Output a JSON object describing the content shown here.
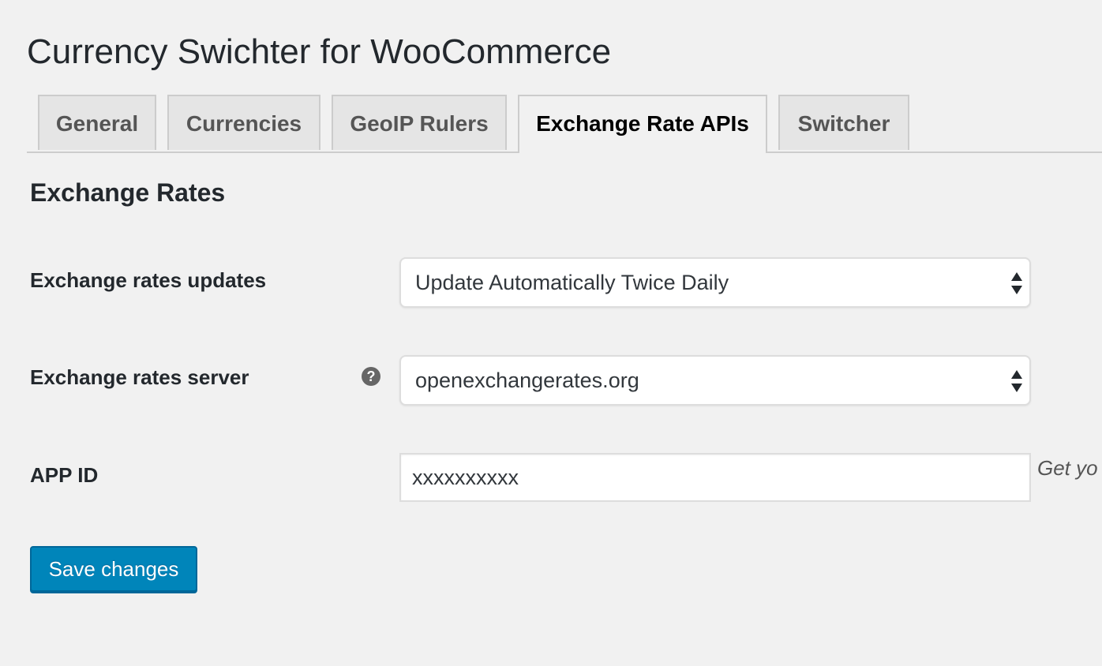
{
  "page": {
    "title": "Currency Swichter for WooCommerce"
  },
  "tabs": [
    {
      "label": "General",
      "active": false
    },
    {
      "label": "Currencies",
      "active": false
    },
    {
      "label": "GeoIP Rulers",
      "active": false
    },
    {
      "label": "Exchange Rate APIs",
      "active": true
    },
    {
      "label": "Switcher",
      "active": false
    }
  ],
  "section": {
    "title": "Exchange Rates"
  },
  "fields": {
    "updates": {
      "label": "Exchange rates updates",
      "value": "Update Automatically Twice Daily"
    },
    "server": {
      "label": "Exchange rates server",
      "help_icon": "help-icon",
      "help_glyph": "?",
      "value": "openexchangerates.org"
    },
    "app_id": {
      "label": "APP ID",
      "value": "xxxxxxxxxx",
      "description": "Get yo"
    }
  },
  "actions": {
    "save_label": "Save changes"
  },
  "colors": {
    "background": "#f1f1f1",
    "primary_button": "#0085ba",
    "text": "#23282d"
  }
}
